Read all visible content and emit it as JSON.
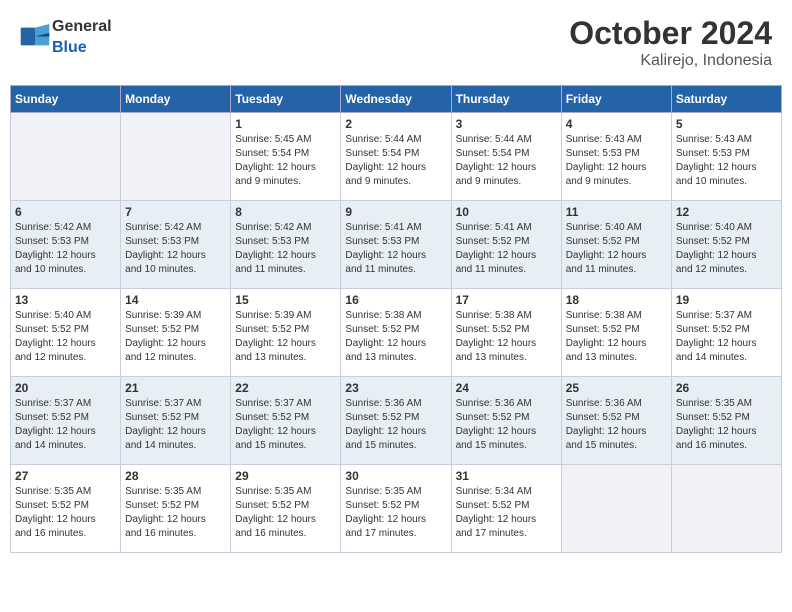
{
  "header": {
    "logo_general": "General",
    "logo_blue": "Blue",
    "month": "October 2024",
    "location": "Kalirejo, Indonesia"
  },
  "weekdays": [
    "Sunday",
    "Monday",
    "Tuesday",
    "Wednesday",
    "Thursday",
    "Friday",
    "Saturday"
  ],
  "weeks": [
    [
      {
        "day": "",
        "content": ""
      },
      {
        "day": "",
        "content": ""
      },
      {
        "day": "1",
        "content": "Sunrise: 5:45 AM\nSunset: 5:54 PM\nDaylight: 12 hours\nand 9 minutes."
      },
      {
        "day": "2",
        "content": "Sunrise: 5:44 AM\nSunset: 5:54 PM\nDaylight: 12 hours\nand 9 minutes."
      },
      {
        "day": "3",
        "content": "Sunrise: 5:44 AM\nSunset: 5:54 PM\nDaylight: 12 hours\nand 9 minutes."
      },
      {
        "day": "4",
        "content": "Sunrise: 5:43 AM\nSunset: 5:53 PM\nDaylight: 12 hours\nand 9 minutes."
      },
      {
        "day": "5",
        "content": "Sunrise: 5:43 AM\nSunset: 5:53 PM\nDaylight: 12 hours\nand 10 minutes."
      }
    ],
    [
      {
        "day": "6",
        "content": "Sunrise: 5:42 AM\nSunset: 5:53 PM\nDaylight: 12 hours\nand 10 minutes."
      },
      {
        "day": "7",
        "content": "Sunrise: 5:42 AM\nSunset: 5:53 PM\nDaylight: 12 hours\nand 10 minutes."
      },
      {
        "day": "8",
        "content": "Sunrise: 5:42 AM\nSunset: 5:53 PM\nDaylight: 12 hours\nand 11 minutes."
      },
      {
        "day": "9",
        "content": "Sunrise: 5:41 AM\nSunset: 5:53 PM\nDaylight: 12 hours\nand 11 minutes."
      },
      {
        "day": "10",
        "content": "Sunrise: 5:41 AM\nSunset: 5:52 PM\nDaylight: 12 hours\nand 11 minutes."
      },
      {
        "day": "11",
        "content": "Sunrise: 5:40 AM\nSunset: 5:52 PM\nDaylight: 12 hours\nand 11 minutes."
      },
      {
        "day": "12",
        "content": "Sunrise: 5:40 AM\nSunset: 5:52 PM\nDaylight: 12 hours\nand 12 minutes."
      }
    ],
    [
      {
        "day": "13",
        "content": "Sunrise: 5:40 AM\nSunset: 5:52 PM\nDaylight: 12 hours\nand 12 minutes."
      },
      {
        "day": "14",
        "content": "Sunrise: 5:39 AM\nSunset: 5:52 PM\nDaylight: 12 hours\nand 12 minutes."
      },
      {
        "day": "15",
        "content": "Sunrise: 5:39 AM\nSunset: 5:52 PM\nDaylight: 12 hours\nand 13 minutes."
      },
      {
        "day": "16",
        "content": "Sunrise: 5:38 AM\nSunset: 5:52 PM\nDaylight: 12 hours\nand 13 minutes."
      },
      {
        "day": "17",
        "content": "Sunrise: 5:38 AM\nSunset: 5:52 PM\nDaylight: 12 hours\nand 13 minutes."
      },
      {
        "day": "18",
        "content": "Sunrise: 5:38 AM\nSunset: 5:52 PM\nDaylight: 12 hours\nand 13 minutes."
      },
      {
        "day": "19",
        "content": "Sunrise: 5:37 AM\nSunset: 5:52 PM\nDaylight: 12 hours\nand 14 minutes."
      }
    ],
    [
      {
        "day": "20",
        "content": "Sunrise: 5:37 AM\nSunset: 5:52 PM\nDaylight: 12 hours\nand 14 minutes."
      },
      {
        "day": "21",
        "content": "Sunrise: 5:37 AM\nSunset: 5:52 PM\nDaylight: 12 hours\nand 14 minutes."
      },
      {
        "day": "22",
        "content": "Sunrise: 5:37 AM\nSunset: 5:52 PM\nDaylight: 12 hours\nand 15 minutes."
      },
      {
        "day": "23",
        "content": "Sunrise: 5:36 AM\nSunset: 5:52 PM\nDaylight: 12 hours\nand 15 minutes."
      },
      {
        "day": "24",
        "content": "Sunrise: 5:36 AM\nSunset: 5:52 PM\nDaylight: 12 hours\nand 15 minutes."
      },
      {
        "day": "25",
        "content": "Sunrise: 5:36 AM\nSunset: 5:52 PM\nDaylight: 12 hours\nand 15 minutes."
      },
      {
        "day": "26",
        "content": "Sunrise: 5:35 AM\nSunset: 5:52 PM\nDaylight: 12 hours\nand 16 minutes."
      }
    ],
    [
      {
        "day": "27",
        "content": "Sunrise: 5:35 AM\nSunset: 5:52 PM\nDaylight: 12 hours\nand 16 minutes."
      },
      {
        "day": "28",
        "content": "Sunrise: 5:35 AM\nSunset: 5:52 PM\nDaylight: 12 hours\nand 16 minutes."
      },
      {
        "day": "29",
        "content": "Sunrise: 5:35 AM\nSunset: 5:52 PM\nDaylight: 12 hours\nand 16 minutes."
      },
      {
        "day": "30",
        "content": "Sunrise: 5:35 AM\nSunset: 5:52 PM\nDaylight: 12 hours\nand 17 minutes."
      },
      {
        "day": "31",
        "content": "Sunrise: 5:34 AM\nSunset: 5:52 PM\nDaylight: 12 hours\nand 17 minutes."
      },
      {
        "day": "",
        "content": ""
      },
      {
        "day": "",
        "content": ""
      }
    ]
  ]
}
